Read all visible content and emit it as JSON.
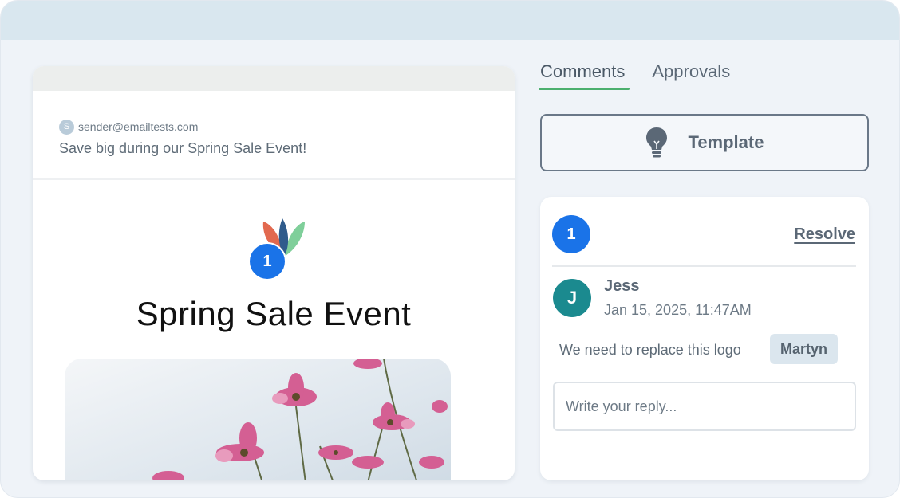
{
  "email": {
    "sender_initial": "S",
    "sender_address": "sender@emailtests.com",
    "subject": "Save big during our Spring Sale Event!",
    "headline": "Spring Sale Event",
    "marker_number": "1"
  },
  "tabs": [
    {
      "label": "Comments",
      "active": true
    },
    {
      "label": "Approvals",
      "active": false
    }
  ],
  "template_button": {
    "label": "Template",
    "icon": "lightbulb-icon"
  },
  "comment": {
    "marker_number": "1",
    "resolve_label": "Resolve",
    "author_initial": "J",
    "author_name": "Jess",
    "timestamp": "Jan 15, 2025, 11:47AM",
    "text": "We need to replace this logo",
    "mention": "Martyn"
  },
  "reply": {
    "placeholder": "Write your reply..."
  },
  "colors": {
    "accent_blue": "#1a73e8",
    "tab_underline_green": "#4caf6e",
    "avatar_teal": "#1b8a8f",
    "logo_red": "#e2694f",
    "logo_navy": "#2f5b8c",
    "logo_green": "#7fcf9a"
  }
}
